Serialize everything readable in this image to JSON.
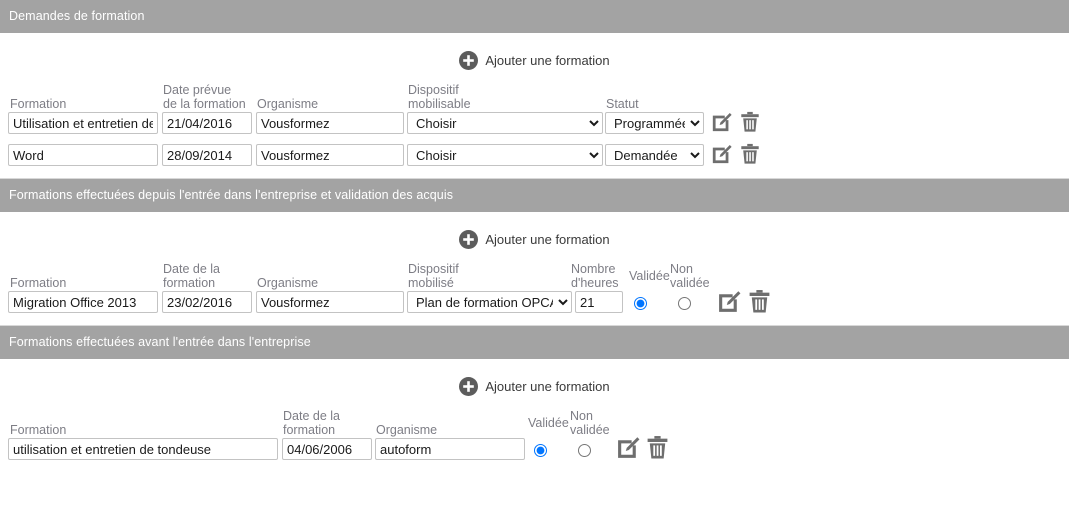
{
  "sections": [
    {
      "id": "demandes",
      "title": "Demandes de formation",
      "add_label": "Ajouter une formation",
      "add_icon": "plus-circle-icon",
      "columns": [
        "Formation",
        "Date prévue\nde la formation",
        "Organisme",
        "Dispositif\nmobilisable",
        "Statut"
      ],
      "rows": [
        {
          "formation": "Utilisation et entretien de",
          "date": "21/04/2016",
          "organisme": "Vousformez",
          "dispositif": "Choisir",
          "statut": "Programmée",
          "edit_icon": "edit-pencil-icon",
          "delete_icon": "trash-icon"
        },
        {
          "formation": "Word",
          "date": "28/09/2014",
          "organisme": "Vousformez",
          "dispositif": "Choisir",
          "statut": "Demandée",
          "edit_icon": "edit-pencil-icon",
          "delete_icon": "trash-icon"
        }
      ]
    },
    {
      "id": "effectuees-depuis",
      "title": "Formations effectuées depuis l'entrée dans l'entreprise et validation des acquis",
      "add_label": "Ajouter une formation",
      "add_icon": "plus-circle-icon",
      "columns": [
        "Formation",
        "Date de la\nformation",
        "Organisme",
        "Dispositif\nmobilisé",
        "Nombre\nd'heures",
        "Validée",
        "Non\nvalidée"
      ],
      "rows": [
        {
          "formation": "Migration Office 2013",
          "date": "23/02/2016",
          "organisme": "Vousformez",
          "dispositif": "Plan de formation OPCA",
          "heures": "21",
          "validee_selected": true,
          "edit_icon": "edit-pencil-icon",
          "delete_icon": "trash-icon"
        }
      ]
    },
    {
      "id": "effectuees-avant",
      "title": "Formations effectuées avant l'entrée dans l'entreprise",
      "add_label": "Ajouter une formation",
      "add_icon": "plus-circle-icon",
      "columns": [
        "Formation",
        "Date de la\nformation",
        "Organisme",
        "Validée",
        "Non\nvalidée"
      ],
      "rows": [
        {
          "formation": "utilisation et entretien de tondeuse",
          "date": "04/06/2006",
          "organisme": "autoform",
          "validee_selected": true,
          "edit_icon": "edit-pencil-icon",
          "delete_icon": "trash-icon"
        }
      ]
    }
  ],
  "colors": {
    "header_bar": "#a3a3a3",
    "header_text": "#ffffff",
    "label_text": "#7d7d85",
    "icon_gray": "#6e6e6e",
    "radio_accent": "#1a73b8",
    "field_border": "#c3c3c3"
  }
}
